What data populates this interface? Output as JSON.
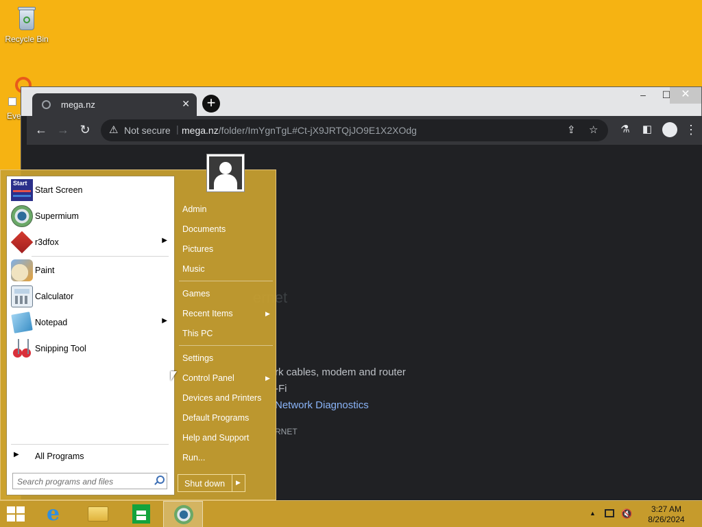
{
  "desktop": {
    "icons": [
      {
        "label": "Recycle Bin",
        "icon": "recycle-bin-icon"
      },
      {
        "label": "Eve",
        "icon": "app-shortcut-icon"
      }
    ]
  },
  "browser": {
    "tab": {
      "title": "mega.nz",
      "icon": "globe-icon"
    },
    "window_controls": {
      "minimize": "–",
      "maximize": "☐",
      "close": "✕"
    },
    "toolbar": {
      "back": "←",
      "forward": "→",
      "reload": "↻"
    },
    "omnibox": {
      "security_label": "Not secure",
      "host": "mega.nz",
      "path": "/folder/ImYgnTgL#Ct-jX9JRTQjJO9E1X2XOdg"
    },
    "page": {
      "partial_heading": "ernet",
      "line1": "rk cables, modem and router",
      "line2": "-Fi",
      "link": "Network Diagnostics",
      "error_code": "RNET"
    }
  },
  "start_menu": {
    "pinned": [
      {
        "label": "Start Screen",
        "icon": "start-screen-icon",
        "submenu": false
      },
      {
        "label": "Supermium",
        "icon": "supermium-icon",
        "submenu": false
      },
      {
        "label": "r3dfox",
        "icon": "r3dfox-icon",
        "submenu": true
      }
    ],
    "recent": [
      {
        "label": "Paint",
        "icon": "paint-icon",
        "submenu": false
      },
      {
        "label": "Calculator",
        "icon": "calculator-icon",
        "submenu": false
      },
      {
        "label": "Notepad",
        "icon": "notepad-icon",
        "submenu": true
      },
      {
        "label": "Snipping Tool",
        "icon": "snipping-tool-icon",
        "submenu": false
      }
    ],
    "start_icon_text": "Start",
    "all_programs": "All Programs",
    "search_placeholder": "Search programs and files",
    "right": {
      "group1": [
        "Admin",
        "Documents",
        "Pictures",
        "Music"
      ],
      "group2": [
        "Games",
        "Recent Items",
        "This PC"
      ],
      "group3": [
        "Settings",
        "Control Panel",
        "Devices and Printers",
        "Default Programs",
        "Help and Support",
        "Run..."
      ]
    },
    "shutdown": "Shut down"
  },
  "taskbar": {
    "apps": [
      {
        "name": "Internet Explorer",
        "icon": "internet-explorer-icon"
      },
      {
        "name": "File Explorer",
        "icon": "file-explorer-icon"
      },
      {
        "name": "Store",
        "icon": "store-icon"
      },
      {
        "name": "Supermium",
        "icon": "supermium-icon",
        "active": true
      }
    ],
    "clock": {
      "time": "3:27 AM",
      "date": "8/26/2024"
    }
  }
}
